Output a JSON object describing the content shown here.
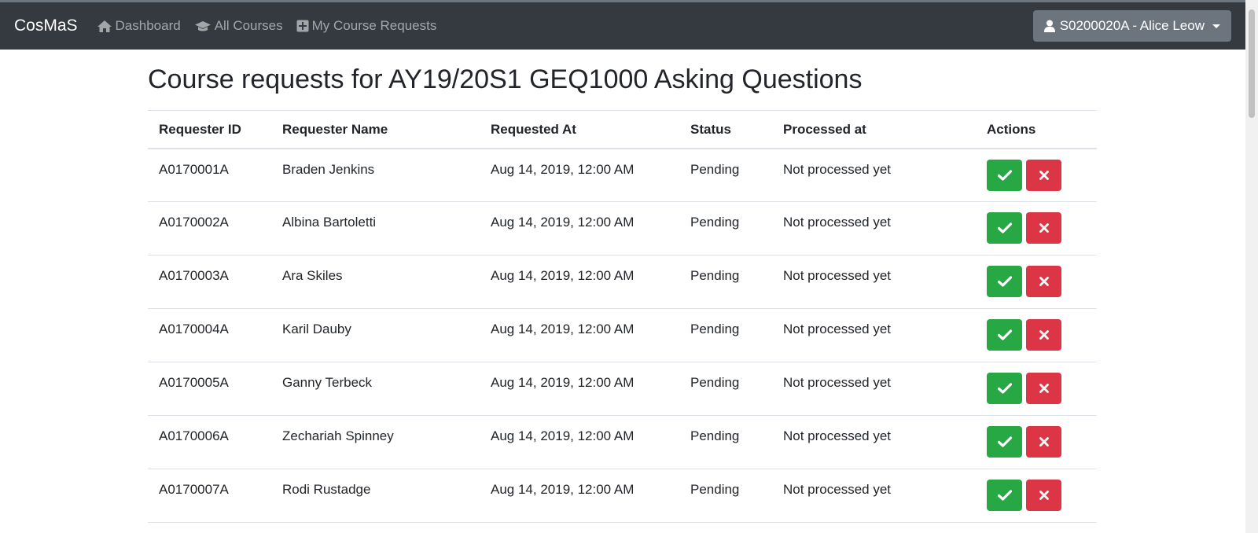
{
  "navbar": {
    "brand": "CosMaS",
    "links": [
      {
        "label": "Dashboard",
        "icon": "home-icon"
      },
      {
        "label": "All Courses",
        "icon": "graduation-cap-icon"
      },
      {
        "label": "My Course Requests",
        "icon": "plus-square-icon"
      }
    ],
    "user": "S0200020A - Alice Leow"
  },
  "page": {
    "title": "Course requests for AY19/20S1 GEQ1000 Asking Questions"
  },
  "table": {
    "headers": [
      "Requester ID",
      "Requester Name",
      "Requested At",
      "Status",
      "Processed at",
      "Actions"
    ],
    "rows": [
      {
        "id": "A0170001A",
        "name": "Braden Jenkins",
        "requested_at": "Aug 14, 2019, 12:00 AM",
        "status": "Pending",
        "processed_at": "Not processed yet"
      },
      {
        "id": "A0170002A",
        "name": "Albina Bartoletti",
        "requested_at": "Aug 14, 2019, 12:00 AM",
        "status": "Pending",
        "processed_at": "Not processed yet"
      },
      {
        "id": "A0170003A",
        "name": "Ara Skiles",
        "requested_at": "Aug 14, 2019, 12:00 AM",
        "status": "Pending",
        "processed_at": "Not processed yet"
      },
      {
        "id": "A0170004A",
        "name": "Karil Dauby",
        "requested_at": "Aug 14, 2019, 12:00 AM",
        "status": "Pending",
        "processed_at": "Not processed yet"
      },
      {
        "id": "A0170005A",
        "name": "Ganny Terbeck",
        "requested_at": "Aug 14, 2019, 12:00 AM",
        "status": "Pending",
        "processed_at": "Not processed yet"
      },
      {
        "id": "A0170006A",
        "name": "Zechariah Spinney",
        "requested_at": "Aug 14, 2019, 12:00 AM",
        "status": "Pending",
        "processed_at": "Not processed yet"
      },
      {
        "id": "A0170007A",
        "name": "Rodi Rustadge",
        "requested_at": "Aug 14, 2019, 12:00 AM",
        "status": "Pending",
        "processed_at": "Not processed yet"
      }
    ]
  },
  "colors": {
    "navbar": "#343a40",
    "approve": "#28a745",
    "reject": "#dc3545",
    "user_button": "#6c757d"
  }
}
